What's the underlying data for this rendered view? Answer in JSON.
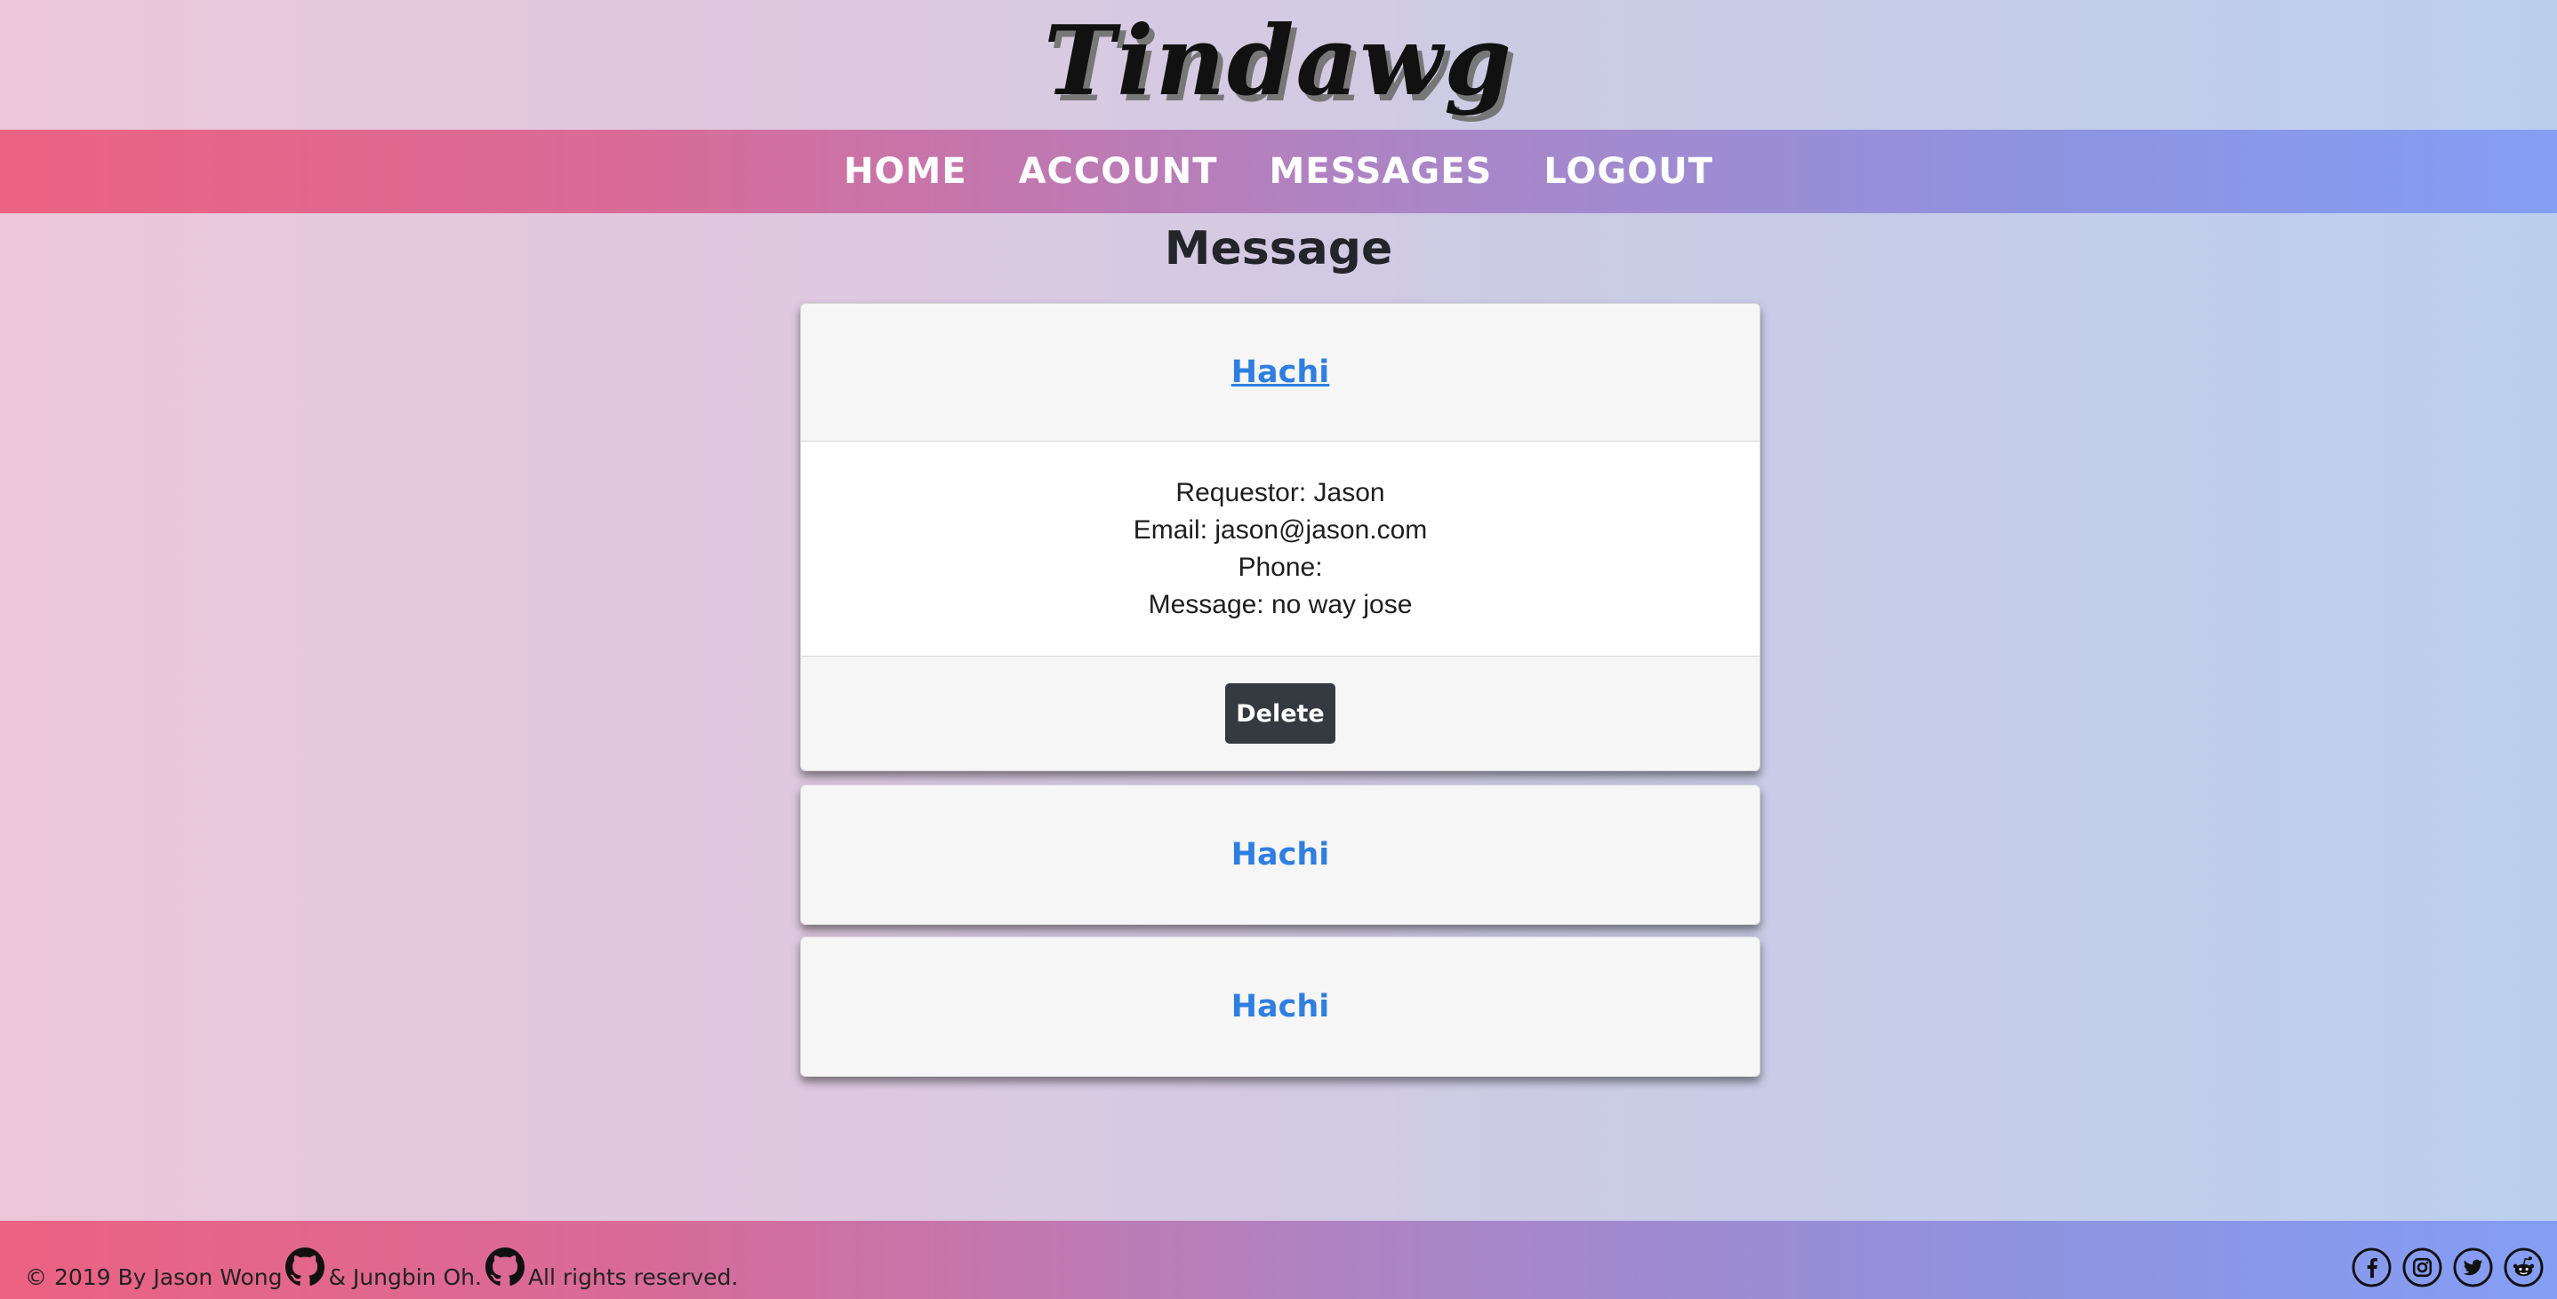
{
  "brand": {
    "logo_text": "Tindawg"
  },
  "nav": {
    "items": [
      "HOME",
      "ACCOUNT",
      "MESSAGES",
      "LOGOUT"
    ]
  },
  "page": {
    "title": "Message"
  },
  "cards": [
    {
      "title": "Hachi",
      "expanded": true,
      "lines": [
        "Requestor: Jason",
        "Email: jason@jason.com",
        "Phone:",
        "Message: no way jose"
      ],
      "delete_label": "Delete"
    },
    {
      "title": "Hachi",
      "expanded": false
    },
    {
      "title": "Hachi",
      "expanded": false
    }
  ],
  "footer": {
    "copyright_prefix": "© 2019 By Jason Wong",
    "middle": "& Jungbin Oh.",
    "suffix": "All rights reserved.",
    "icons": [
      "github-icon",
      "facebook-icon",
      "instagram-icon",
      "twitter-icon",
      "reddit-icon"
    ]
  },
  "colors": {
    "accent_pink": "#ec6282",
    "accent_blue": "#849ef5",
    "link_blue": "#2f7ee0",
    "button_dark": "#343a40"
  }
}
